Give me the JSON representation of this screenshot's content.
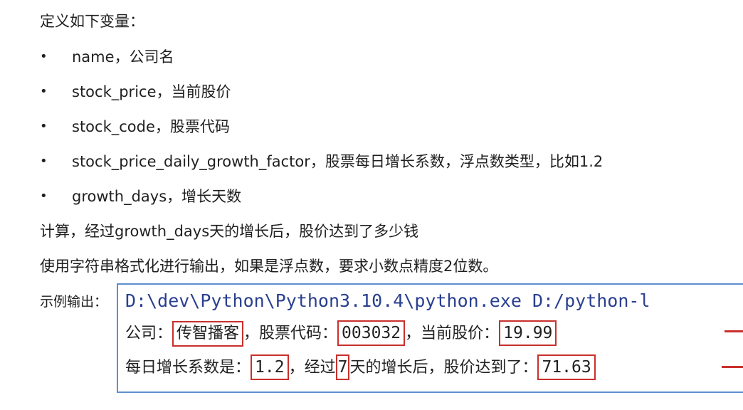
{
  "heading": "定义如下变量：",
  "bullets": [
    "name，公司名",
    "stock_price，当前股价",
    "stock_code，股票代码",
    "stock_price_daily_growth_factor，股票每日增长系数，浮点数类型，比如1.2",
    "growth_days，增长天数"
  ],
  "bullet_symbol": "•",
  "paragraphs": [
    "计算，经过growth_days天的增长后，股价达到了多少钱",
    "使用字符串格式化进行输出，如果是浮点数，要求小数点精度2位数。"
  ],
  "example_label": "示例输出：",
  "console": {
    "command": "D:\\dev\\Python\\Python3.10.4\\python.exe D:/python-l",
    "line1": {
      "t1": "公司：",
      "company": "传智播客",
      "t2": "，股票代码：",
      "code": "003032",
      "t3": "，当前股价：",
      "price": "19.99"
    },
    "line2": {
      "t1": "每日增长系数是：",
      "factor": "1.2",
      "t2": "，经过",
      "days": "7",
      "t3": "天的增长后，股价达到了：",
      "result": "71.63"
    }
  },
  "colors": {
    "highlight_box": "#c9302c",
    "console_border": "#5d8fd0",
    "command_text": "#2a3f8f"
  }
}
